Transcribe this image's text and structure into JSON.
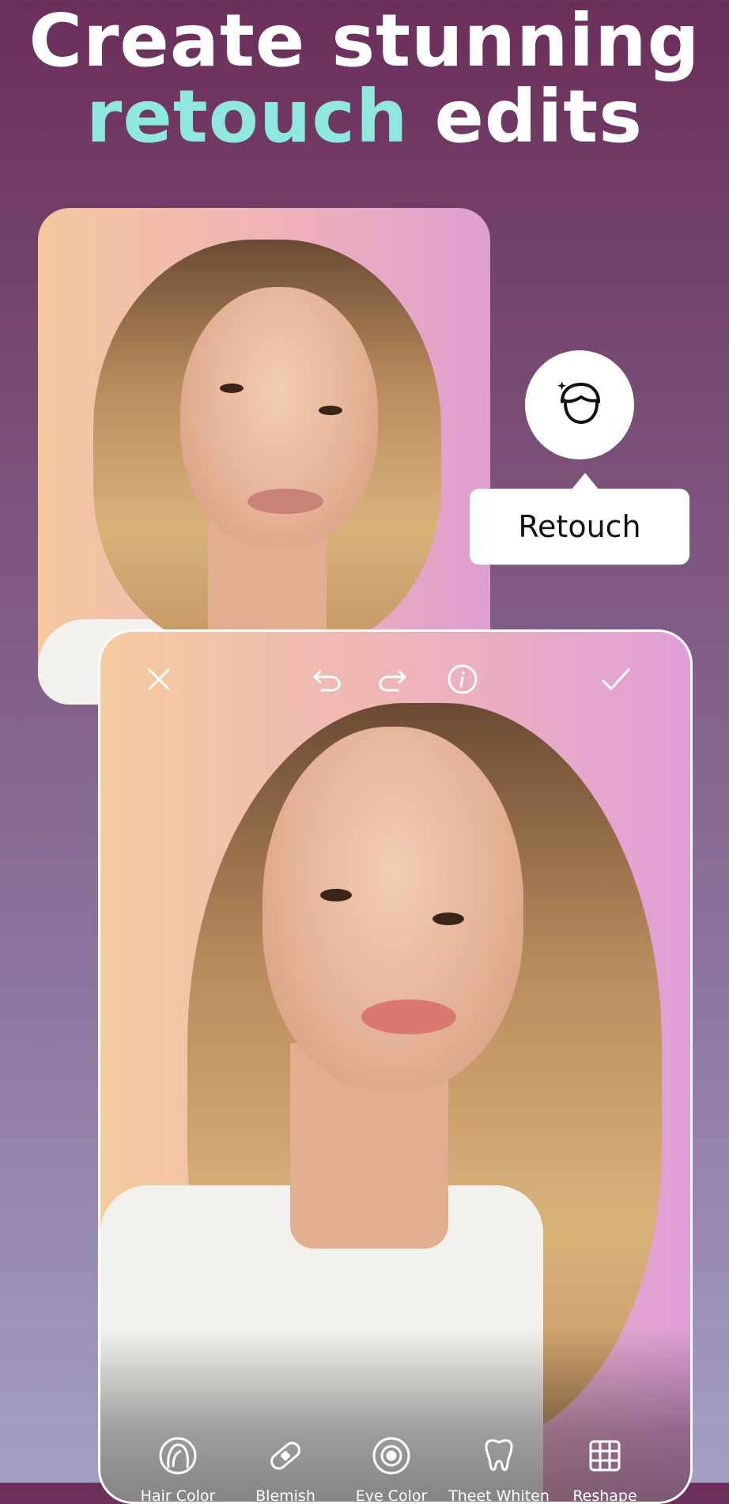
{
  "headline": {
    "line1": "Create stunning",
    "line2_accent": "retouch",
    "line2_rest": " edits",
    "accent_color": "#8fe8dc"
  },
  "feature_badge": {
    "icon": "face-retouch-icon",
    "label": "Retouch"
  },
  "editor_toolbar": {
    "close_icon": "close-icon",
    "undo_icon": "undo-icon",
    "redo_icon": "redo-icon",
    "info_icon": "info-icon",
    "confirm_icon": "check-icon"
  },
  "tools": [
    {
      "label": "Hair Color",
      "icon": "hair-icon"
    },
    {
      "label": "Blemish",
      "icon": "bandage-icon"
    },
    {
      "label": "Eye Color",
      "icon": "eye-iris-icon"
    },
    {
      "label": "Theet Whiten",
      "icon": "tooth-icon"
    },
    {
      "label": "Reshape",
      "icon": "grid-icon"
    }
  ],
  "colors": {
    "background_top": "#6b2f5a",
    "background_bottom": "#a59fc4",
    "card_gradient_left": "#f4c89e",
    "card_gradient_right": "#de9fcf"
  }
}
